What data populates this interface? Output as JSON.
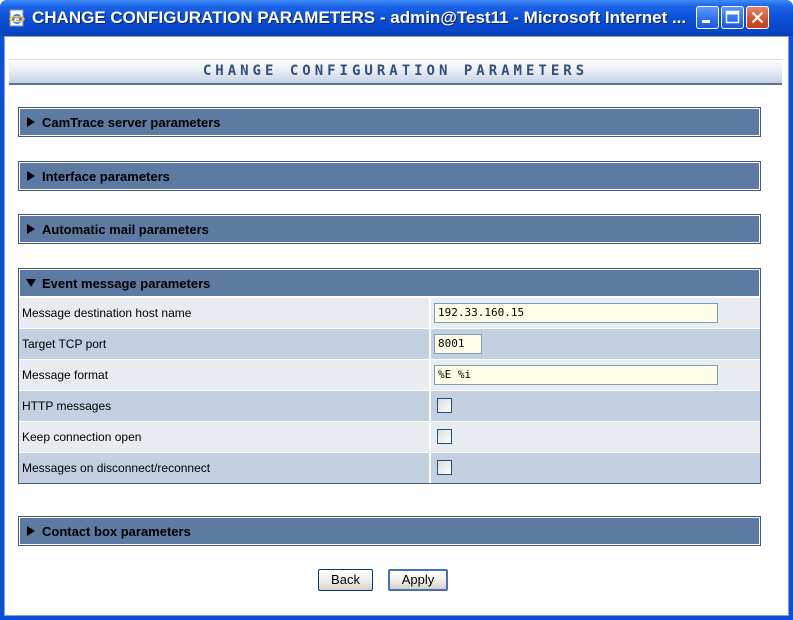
{
  "window": {
    "title": "CHANGE CONFIGURATION PARAMETERS - admin@Test11 - Microsoft Internet ..."
  },
  "page": {
    "title": "CHANGE CONFIGURATION PARAMETERS"
  },
  "sections": {
    "camtrace": {
      "label": "CamTrace server parameters",
      "expanded": false
    },
    "interface": {
      "label": "Interface parameters",
      "expanded": false
    },
    "mail": {
      "label": "Automatic mail parameters",
      "expanded": false
    },
    "event": {
      "label": "Event message parameters",
      "expanded": true,
      "rows": [
        {
          "label": "Message destination host name",
          "type": "text",
          "value": "192.33.160.15"
        },
        {
          "label": "Target TCP port",
          "type": "text",
          "value": "8001"
        },
        {
          "label": "Message format",
          "type": "text",
          "value": "%E %i"
        },
        {
          "label": "HTTP messages",
          "type": "checkbox",
          "checked": false
        },
        {
          "label": "Keep connection open",
          "type": "checkbox",
          "checked": false
        },
        {
          "label": "Messages on disconnect/reconnect",
          "type": "checkbox",
          "checked": false
        }
      ]
    },
    "contact": {
      "label": "Contact box parameters",
      "expanded": false
    }
  },
  "buttons": {
    "back": "Back",
    "apply": "Apply"
  },
  "colors": {
    "section_header": "#5d7aa3",
    "row_light": "#e8ecf1",
    "row_dark": "#c2d0e1",
    "input_bg": "#ffffe7",
    "titlebar": "#0a4fd8"
  },
  "icons": {
    "title": "ie-page-icon",
    "collapsed": "triangle-right-icon",
    "expanded": "triangle-down-icon"
  }
}
